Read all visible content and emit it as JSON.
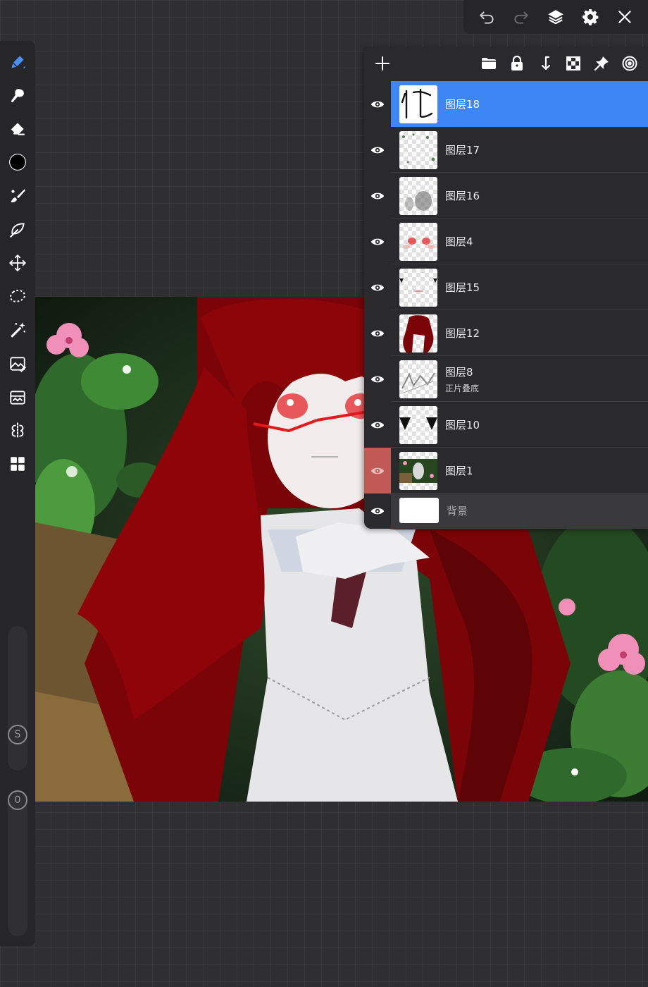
{
  "top_toolbar": {
    "buttons": [
      {
        "name": "undo-button",
        "icon": "undo-icon"
      },
      {
        "name": "redo-button",
        "icon": "redo-icon"
      },
      {
        "name": "layers-button",
        "icon": "layers-icon"
      },
      {
        "name": "settings-button",
        "icon": "gear-icon"
      },
      {
        "name": "close-button",
        "icon": "close-icon"
      }
    ]
  },
  "left_toolbar": {
    "tools": [
      {
        "name": "pen-tool",
        "icon": "pen-icon",
        "active": true
      },
      {
        "name": "smudge-tool",
        "icon": "smudge-icon"
      },
      {
        "name": "eraser-tool",
        "icon": "eraser-icon"
      },
      {
        "name": "color-picker",
        "icon": "color-swatch-icon",
        "color": "#000000"
      },
      {
        "name": "brush-tool",
        "icon": "brush-icon"
      },
      {
        "name": "fill-tool",
        "icon": "leaf-icon"
      },
      {
        "name": "transform-tool",
        "icon": "move-icon"
      },
      {
        "name": "lasso-tool",
        "icon": "lasso-icon"
      },
      {
        "name": "magic-wand-tool",
        "icon": "magic-wand-icon"
      },
      {
        "name": "image-tool",
        "icon": "image-edit-icon"
      },
      {
        "name": "reference-tool",
        "icon": "reference-icon"
      },
      {
        "name": "symmetry-tool",
        "icon": "symmetry-icon"
      },
      {
        "name": "gallery-tool",
        "icon": "grid-icon"
      }
    ],
    "size_slider": {
      "label": "S"
    },
    "opacity_slider": {
      "label": "0"
    }
  },
  "layers_panel": {
    "header_icons": [
      "add-icon",
      "folder-icon",
      "lock-icon",
      "merge-down-icon",
      "checkerboard-icon",
      "pin-icon",
      "target-icon"
    ],
    "layers": [
      {
        "name": "图层18",
        "selected": true,
        "visible": true
      },
      {
        "name": "图层17",
        "visible": true
      },
      {
        "name": "图层16",
        "visible": true
      },
      {
        "name": "图层4",
        "visible": true
      },
      {
        "name": "图层15",
        "visible": true
      },
      {
        "name": "图层12",
        "visible": true
      },
      {
        "name": "图层8",
        "blend_mode": "正片叠底",
        "visible": true
      },
      {
        "name": "图层10",
        "visible": true
      },
      {
        "name": "图层1",
        "visible": true,
        "clipped": true
      }
    ],
    "background_layer": {
      "name": "背景",
      "visible": true,
      "color": "#ffffff"
    },
    "colors": {
      "selected": "#3d86f3",
      "clip_marker": "#c15a55"
    }
  }
}
